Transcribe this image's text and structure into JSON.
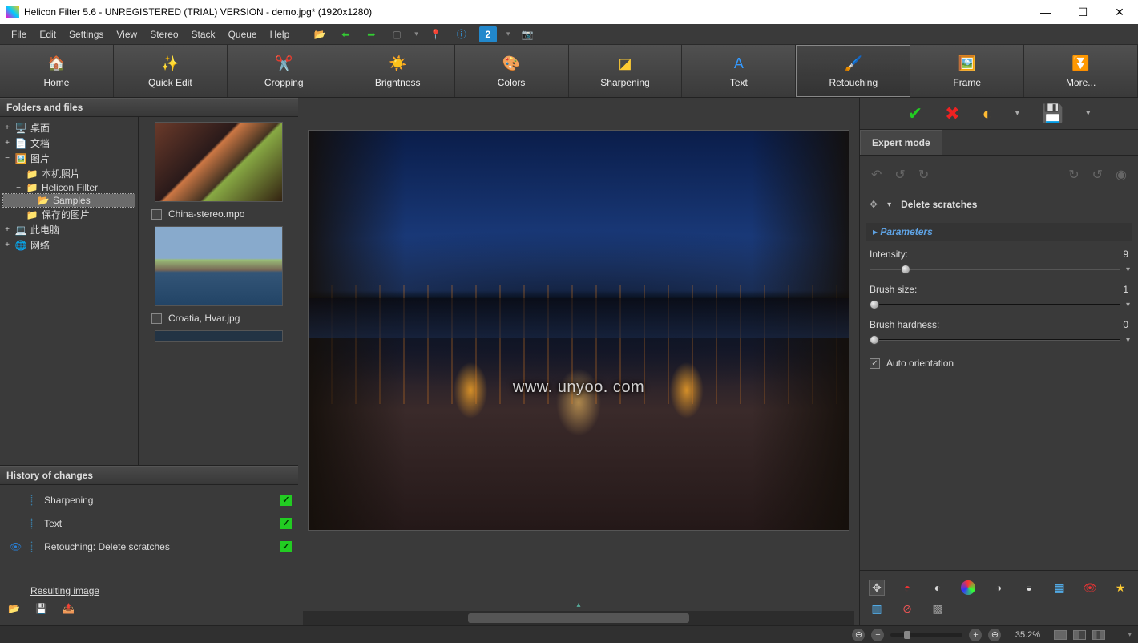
{
  "window": {
    "title": "Helicon Filter 5.6 - UNREGISTERED (TRIAL) VERSION - demo.jpg* (1920x1280)"
  },
  "menubar": [
    "File",
    "Edit",
    "Settings",
    "View",
    "Stereo",
    "Stack",
    "Queue",
    "Help"
  ],
  "maintabs": [
    {
      "label": "Home",
      "icon": "🏠",
      "color": "#3c3"
    },
    {
      "label": "Quick Edit",
      "icon": "✨"
    },
    {
      "label": "Cropping",
      "icon": "✂️"
    },
    {
      "label": "Brightness",
      "icon": "☀️"
    },
    {
      "label": "Colors",
      "icon": "🎨"
    },
    {
      "label": "Sharpening",
      "icon": "◪"
    },
    {
      "label": "Text",
      "icon": "A",
      "color": "#39f"
    },
    {
      "label": "Retouching",
      "icon": "🖌️",
      "selected": true
    },
    {
      "label": "Frame",
      "icon": "🖼️"
    },
    {
      "label": "More...",
      "icon": "⏬"
    }
  ],
  "sidebar": {
    "folders_title": "Folders and files",
    "tree": [
      {
        "exp": "+",
        "icon": "🖥️",
        "label": "桌面",
        "indent": 0
      },
      {
        "exp": "+",
        "icon": "📄",
        "label": "文档",
        "indent": 0
      },
      {
        "exp": "−",
        "icon": "🖼️",
        "label": "图片",
        "indent": 0
      },
      {
        "exp": "",
        "icon": "📁",
        "label": "本机照片",
        "indent": 1
      },
      {
        "exp": "−",
        "icon": "📁",
        "label": "Helicon Filter",
        "indent": 1
      },
      {
        "exp": "",
        "icon": "📂",
        "label": "Samples",
        "indent": 2,
        "selected": true
      },
      {
        "exp": "",
        "icon": "📁",
        "label": "保存的图片",
        "indent": 1
      },
      {
        "exp": "+",
        "icon": "💻",
        "label": "此电脑",
        "indent": 0
      },
      {
        "exp": "+",
        "icon": "🌐",
        "label": "网络",
        "indent": 0
      }
    ],
    "thumbs": [
      {
        "caption": "",
        "img": "street"
      },
      {
        "caption": "China-stereo.mpo",
        "img": ""
      },
      {
        "caption": "",
        "img": "coast"
      },
      {
        "caption": "Croatia, Hvar.jpg",
        "img": ""
      }
    ]
  },
  "history": {
    "title": "History of changes",
    "items": [
      {
        "label": "Sharpening",
        "checked": true
      },
      {
        "label": "Text",
        "checked": true
      },
      {
        "label": "Retouching: Delete scratches",
        "checked": true,
        "eye": true
      }
    ],
    "resulting": "Resulting image"
  },
  "canvas": {
    "watermark": "www. unyoo. com"
  },
  "right": {
    "tab": "Expert mode",
    "preset": "Delete scratches",
    "section": "Parameters",
    "params": [
      {
        "label": "Intensity:",
        "value": "9",
        "knob": 12
      },
      {
        "label": "Brush size:",
        "value": "1",
        "knob": 0
      },
      {
        "label": "Brush hardness:",
        "value": "0",
        "knob": 0
      }
    ],
    "auto_orientation": "Auto orientation"
  },
  "status": {
    "zoom": "35.2%"
  }
}
